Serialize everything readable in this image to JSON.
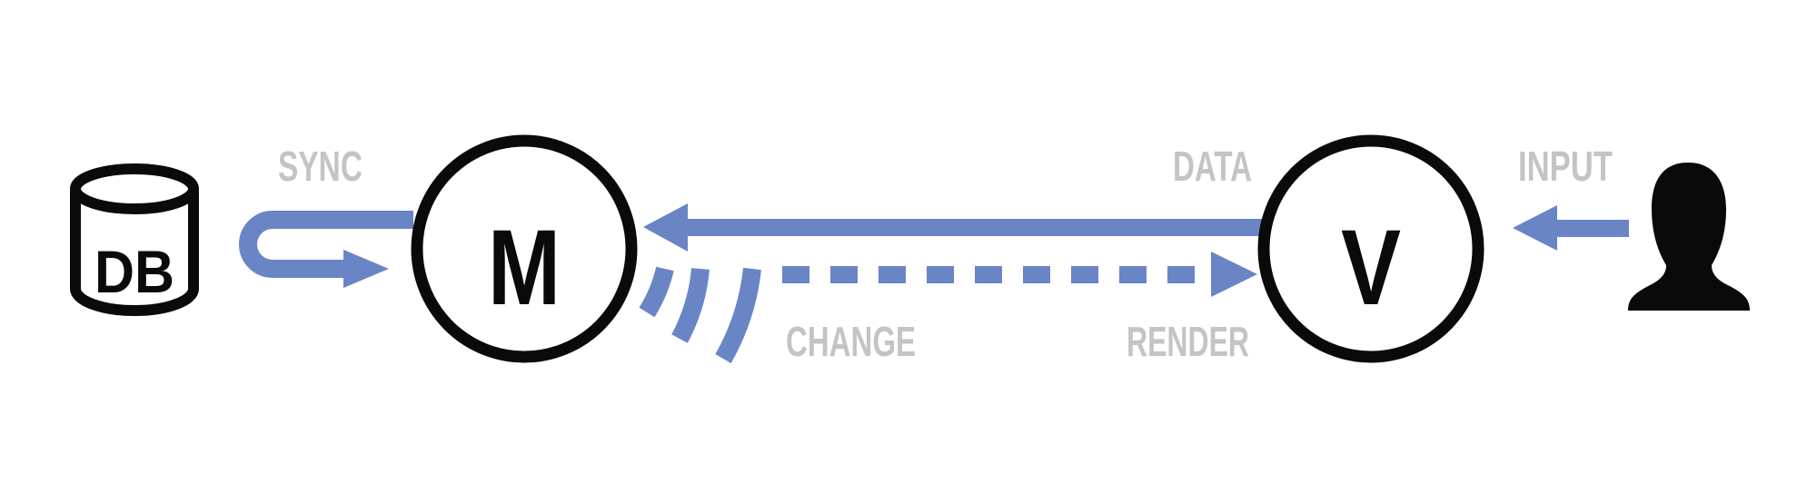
{
  "colors": {
    "arrow": "#6985c6",
    "label": "#c4c4c4",
    "stroke": "#0a0a0a",
    "background": "#ffffff"
  },
  "nodes": {
    "database": {
      "label": "DB",
      "icon": "database-cylinder-icon"
    },
    "model": {
      "label": "M"
    },
    "view": {
      "label": "V"
    },
    "user": {
      "icon": "user-silhouette-icon"
    }
  },
  "labels": {
    "sync": "SYNC",
    "data": "DATA",
    "input": "INPUT",
    "change": "CHANGE",
    "render": "RENDER"
  }
}
